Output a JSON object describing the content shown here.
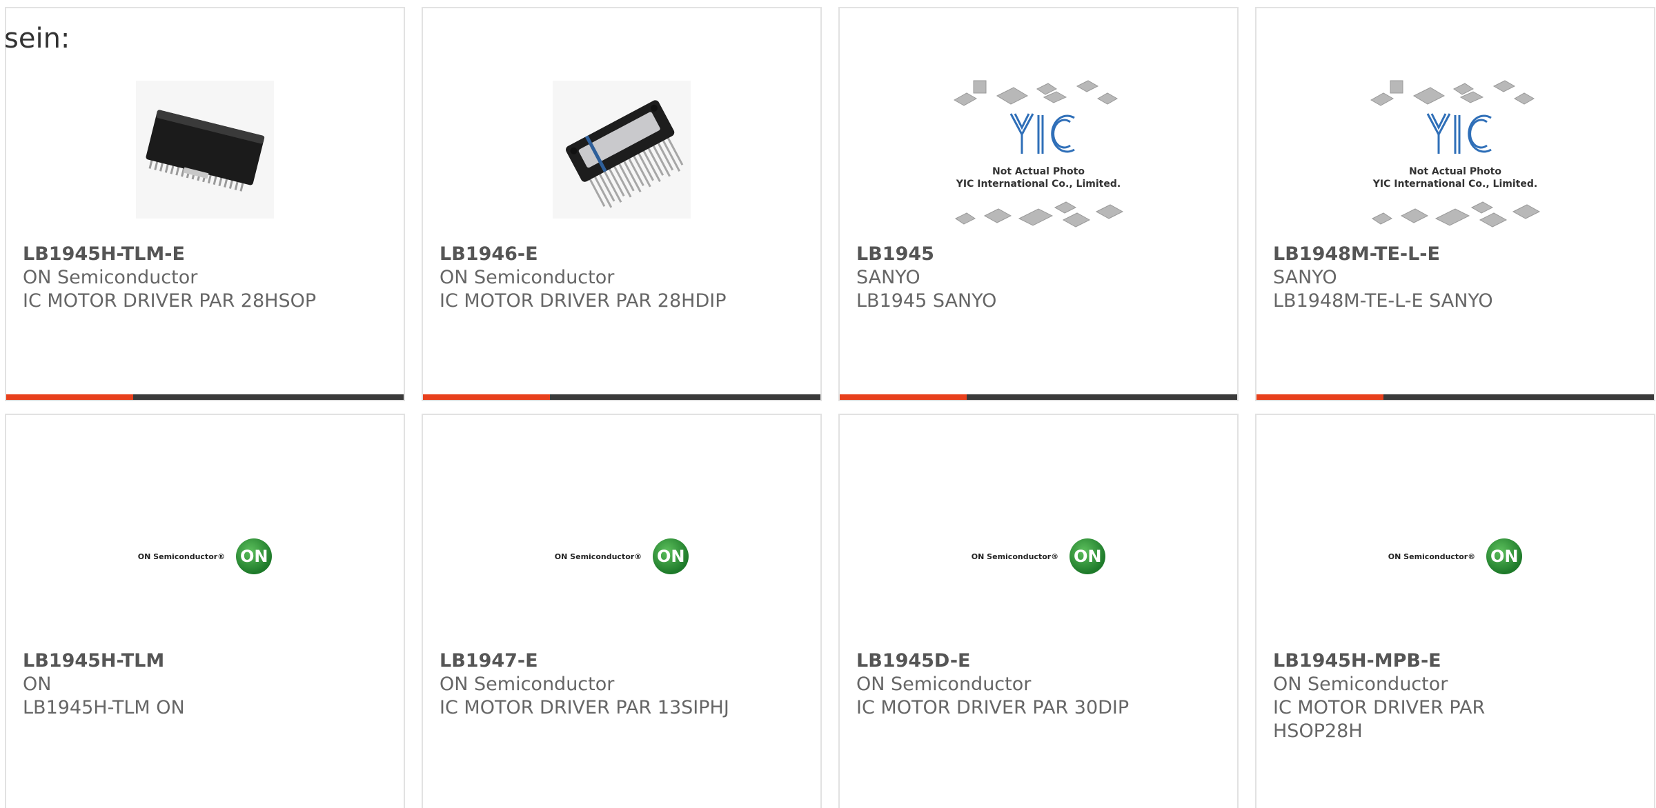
{
  "intro_text": "sein:",
  "colors": {
    "accent": "#e8401c",
    "bar": "#3a3a3a",
    "card_border": "#e2e2e2",
    "on_green": "#2a8a36"
  },
  "products": [
    {
      "part": "LB1945H-TLM-E",
      "manufacturer": "ON Semiconductor",
      "description": "IC MOTOR DRIVER PAR 28HSOP",
      "image": "ic-chip-hsop-photo"
    },
    {
      "part": "LB1946-E",
      "manufacturer": "ON Semiconductor",
      "description": "IC MOTOR DRIVER PAR 28HDIP",
      "image": "ic-chip-hdip-photo"
    },
    {
      "part": "LB1945",
      "manufacturer": "SANYO",
      "description": "LB1945 SANYO",
      "image": "yic-placeholder-photo"
    },
    {
      "part": "LB1948M-TE-L-E",
      "manufacturer": "SANYO",
      "description": "LB1948M-TE-L-E SANYO",
      "image": "yic-placeholder-photo"
    },
    {
      "part": "LB1945H-TLM",
      "manufacturer": "ON",
      "description": "LB1945H-TLM ON",
      "image": "on-semiconductor-logo"
    },
    {
      "part": "LB1947-E",
      "manufacturer": "ON Semiconductor",
      "description": "IC MOTOR DRIVER PAR 13SIPHJ",
      "image": "on-semiconductor-logo"
    },
    {
      "part": "LB1945D-E",
      "manufacturer": "ON Semiconductor",
      "description": "IC MOTOR DRIVER PAR 30DIP",
      "image": "on-semiconductor-logo"
    },
    {
      "part": "LB1945H-MPB-E",
      "manufacturer": "ON Semiconductor",
      "description": "IC MOTOR DRIVER PAR HSOP28H",
      "image": "on-semiconductor-logo"
    }
  ],
  "image_text": {
    "yic_line1": "Not Actual Photo",
    "yic_line2": "YIC International Co., Limited.",
    "yic_logo": "YIC",
    "on_wordmark": "ON Semiconductor®",
    "on_badge": "ON"
  }
}
